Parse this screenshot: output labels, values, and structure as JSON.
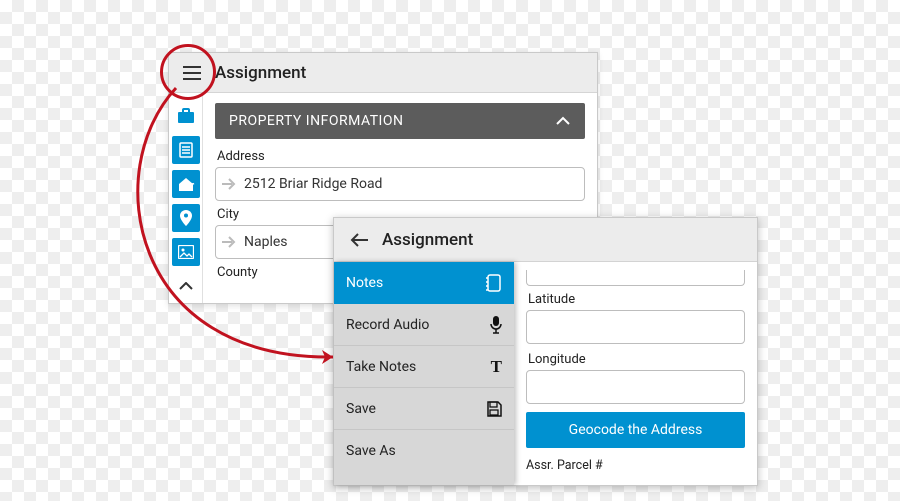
{
  "panel1": {
    "title": "Assignment",
    "section_header": "PROPERTY INFORMATION",
    "fields": {
      "address": {
        "label": "Address",
        "value": "2512 Briar Ridge Road"
      },
      "city": {
        "label": "City",
        "value": "Naples"
      },
      "county": {
        "label": "County"
      }
    },
    "rail": [
      "briefcase",
      "clipboard",
      "home",
      "map-pin",
      "image",
      "caret"
    ]
  },
  "panel2": {
    "title": "Assignment",
    "drawer": [
      {
        "label": "Notes",
        "icon": "notebook",
        "active": true
      },
      {
        "label": "Record Audio",
        "icon": "mic",
        "active": false
      },
      {
        "label": "Take Notes",
        "icon": "text",
        "active": false
      },
      {
        "label": "Save",
        "icon": "floppy",
        "active": false
      },
      {
        "label": "Save As",
        "icon": "none",
        "active": false
      }
    ],
    "right": {
      "latitude_label": "Latitude",
      "longitude_label": "Longitude",
      "geocode_button": "Geocode the Address",
      "parcel_label": "Assr. Parcel #"
    }
  },
  "colors": {
    "accent": "#0091d0",
    "annotation": "#c1121f"
  }
}
